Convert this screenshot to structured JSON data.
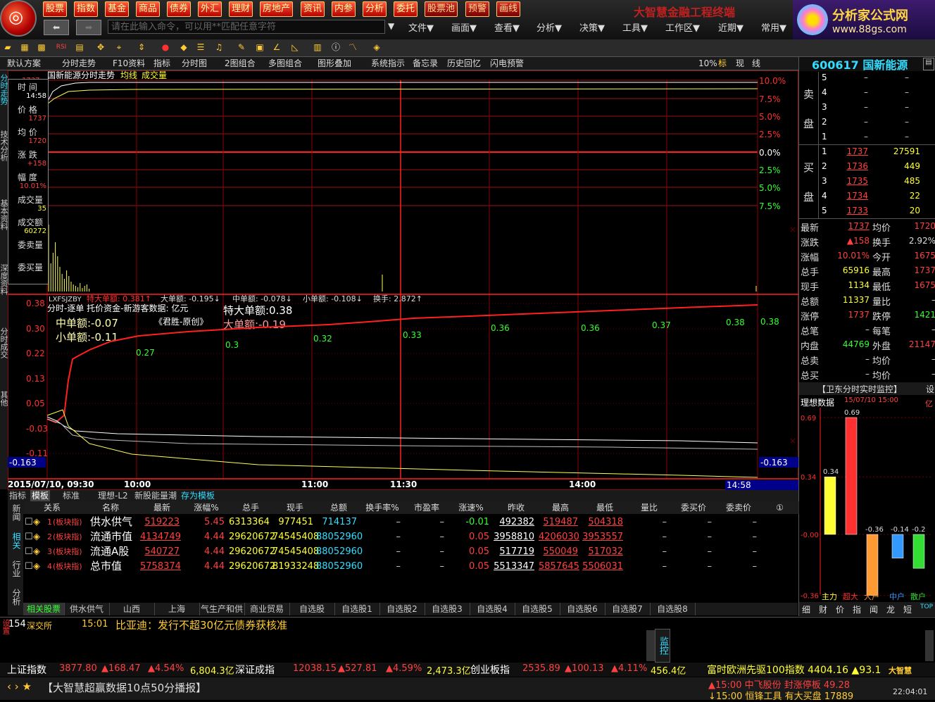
{
  "app": {
    "title": "大智慧金融工程终端",
    "brand_name": "分析家公式网",
    "brand_url": "www.88gs.com",
    "command_placeholder": "请在此输入命令，可以用**匹配任意字符"
  },
  "menu_buttons": [
    "股票",
    "指数",
    "基金",
    "商品",
    "债券",
    "外汇",
    "理财",
    "房地产",
    "资讯",
    "内参",
    "分析",
    "委托",
    "股票池",
    "预警",
    "画线"
  ],
  "menu_right": [
    "文件▼",
    "画面▼",
    "查看▼",
    "分析▼",
    "决策▼",
    "工具▼",
    "工作区▼",
    "近期▼",
    "常用▼"
  ],
  "tabs": [
    "默认方案",
    "分时走势",
    "F10资料",
    "指标",
    "分时图",
    "2图组合",
    "多图组合",
    "图形叠加",
    "系统指示",
    "备忘录",
    "历史回忆",
    "闪电预警"
  ],
  "tab_right": [
    "10%",
    "标",
    "现",
    "线"
  ],
  "left_tabs": [
    "分时走势",
    "技术分析",
    "基本资料",
    "深度资料",
    "分时成交",
    "其他"
  ],
  "chart": {
    "header": "国新能源分时走势",
    "header_avg": "均线",
    "header_vol": "成交量",
    "pct_labels_up": [
      "10.0%",
      "7.5%",
      "5.0%",
      "2.5%",
      "0.0%"
    ],
    "pct_labels_dn": [
      "2.5%",
      "5.0%",
      "7.5%"
    ],
    "price_top": "1737",
    "time_labels": [
      "2015/07/10, 09:30",
      "10:00",
      "11:00",
      "11:30",
      "14:00"
    ],
    "time_current": "14:58",
    "indicator_name": "LXFSJZBY",
    "indicator_items": [
      {
        "label": "特大单额:",
        "value": "0.381↑",
        "color": "red"
      },
      {
        "label": "大单额:",
        "value": "-0.195↓",
        "color": "white"
      },
      {
        "label": "中单额:",
        "value": "-0.078↓",
        "color": "white"
      },
      {
        "label": "小单额:",
        "value": "-0.108↓",
        "color": "white"
      },
      {
        "label": "换手:",
        "value": "2.872↑",
        "color": "white"
      }
    ],
    "sub_title": "分时-逐单 托价资金-新游客数据: 亿元",
    "sub_quote": "《君胜-原创》",
    "sub_mid": "中单额:-0.07",
    "sub_small": "小单额:-0.11",
    "sub_xl": "特大单额:0.38",
    "sub_large": "大单额:-0.19",
    "sub_yaxis": [
      "0.38",
      "0.30",
      "0.22",
      "0.13",
      "0.05",
      "-0.03",
      "-0.11"
    ],
    "sub_current": "-0.163",
    "sub_right_value": "0.38",
    "sub_right_current": "-0.163",
    "sub_points": [
      "0.27",
      "0.3",
      "0.32",
      "0.33",
      "0.36",
      "0.36",
      "0.37",
      "0.38"
    ]
  },
  "infobox": {
    "time_label": "时 间",
    "time": "14:58",
    "price_label": "价 格",
    "price": "1737",
    "avg_label": "均 价",
    "avg": "1720",
    "chg_label": "涨 跌",
    "chg": "+158",
    "amp_label": "幅 度",
    "amp": "10.01%",
    "vol_label": "成交量",
    "vol": "35",
    "amt_label": "成交额",
    "amt": "60272",
    "sell_label": "委卖量",
    "buy_label": "委买量"
  },
  "quote": {
    "code_name": "600617 国新能源",
    "sell_label": "卖",
    "sell_label2": "盘",
    "buy_label": "买",
    "buy_label2": "盘",
    "asks": [
      {
        "lvl": "5",
        "price": "–",
        "vol": "–"
      },
      {
        "lvl": "4",
        "price": "–",
        "vol": "–"
      },
      {
        "lvl": "3",
        "price": "–",
        "vol": "–"
      },
      {
        "lvl": "2",
        "price": "–",
        "vol": "–"
      },
      {
        "lvl": "1",
        "price": "–",
        "vol": "–"
      }
    ],
    "bids": [
      {
        "lvl": "1",
        "price": "1737",
        "vol": "27591"
      },
      {
        "lvl": "2",
        "price": "1736",
        "vol": "449"
      },
      {
        "lvl": "3",
        "price": "1735",
        "vol": "485"
      },
      {
        "lvl": "4",
        "price": "1734",
        "vol": "22"
      },
      {
        "lvl": "5",
        "price": "1733",
        "vol": "20"
      }
    ],
    "stats": [
      {
        "l1": "最新",
        "v1": "1737",
        "c1": "up",
        "l2": "均价",
        "v2": "1720",
        "c2": "up"
      },
      {
        "l1": "涨跌",
        "v1": "▲158",
        "c1": "up",
        "l2": "换手",
        "v2": "2.92%",
        "c2": "wht"
      },
      {
        "l1": "涨幅",
        "v1": "10.01%",
        "c1": "up",
        "l2": "今开",
        "v2": "1675",
        "c2": "up"
      },
      {
        "l1": "总手",
        "v1": "65916",
        "c1": "yel",
        "l2": "最高",
        "v2": "1737",
        "c2": "up"
      },
      {
        "l1": "现手",
        "v1": "1134",
        "c1": "yel",
        "l2": "最低",
        "v2": "1675",
        "c2": "up"
      },
      {
        "l1": "总额",
        "v1": "11337",
        "c1": "yel",
        "l2": "量比",
        "v2": "–",
        "c2": "wht"
      },
      {
        "l1": "涨停",
        "v1": "1737",
        "c1": "up",
        "l2": "跌停",
        "v2": "1421",
        "c2": "dn"
      },
      {
        "l1": "总笔",
        "v1": "–",
        "c1": "wht",
        "l2": "每笔",
        "v2": "–",
        "c2": "wht"
      },
      {
        "l1": "内盘",
        "v1": "44769",
        "c1": "dn",
        "l2": "外盘",
        "v2": "21147",
        "c2": "up"
      },
      {
        "l1": "总卖",
        "v1": "–",
        "c1": "wht",
        "l2": "均价",
        "v2": "–",
        "c2": "wht"
      },
      {
        "l1": "总买",
        "v1": "–",
        "c1": "wht",
        "l2": "均价",
        "v2": "–",
        "c2": "wht"
      }
    ]
  },
  "monitor": {
    "title": "【卫东分时实时监控】",
    "settings": "设",
    "subtitle": "理想数据",
    "date": "15/07/10 15:00",
    "unit": "亿",
    "yaxis": [
      "0.69",
      "0.34",
      "-0.00",
      "-0.36"
    ],
    "bars": [
      {
        "name": "主力",
        "value": 0.34,
        "label": "0.34",
        "color": "#ffff33"
      },
      {
        "name": "超大",
        "value": 0.69,
        "label": "0.69",
        "color": "#ff3030"
      },
      {
        "name": "大户",
        "value": -0.36,
        "label": "-0.36",
        "color": "#ff9933"
      },
      {
        "name": "中户",
        "value": -0.14,
        "label": "-0.14",
        "color": "#3399ff"
      },
      {
        "name": "散户",
        "value": -0.2,
        "label": "-0.2",
        "color": "#33dd33"
      }
    ],
    "bottom_tabs": [
      "细",
      "财",
      "价",
      "指",
      "闻",
      "龙",
      "短",
      "TOP"
    ]
  },
  "table": {
    "top_tabs": [
      "指标",
      "模板",
      "标准",
      "理想-L2",
      "新股能量潮",
      "存为模板"
    ],
    "side_tabs": [
      "新闻",
      "相关",
      "行业",
      "分析"
    ],
    "headers": [
      "关系",
      "名称",
      "最新",
      "涨幅%",
      "总手",
      "现手",
      "总额",
      "换手率%",
      "市盈率",
      "涨速%",
      "昨收",
      "最高",
      "最低",
      "量比",
      "委买价",
      "委卖价"
    ],
    "rows": [
      {
        "idx": "1",
        "rel": "(板块指)",
        "name": "供水供气",
        "last": "519223",
        "pct": "5.45",
        "vol": "6313364",
        "cur": "977451",
        "amt": "714137",
        "turn": "–",
        "pe": "–",
        "speed": "-0.01",
        "prev": "492382",
        "high": "519487",
        "low": "504318",
        "ratio": "–",
        "bid": "–",
        "ask": "–"
      },
      {
        "idx": "2",
        "rel": "(板块指)",
        "name": "流通市值",
        "last": "4134749",
        "pct": "4.44",
        "vol": "29620672",
        "cur": "74545408",
        "amt": "88052960",
        "turn": "–",
        "pe": "–",
        "speed": "0.05",
        "prev": "3958810",
        "high": "4206030",
        "low": "3953557",
        "ratio": "–",
        "bid": "–",
        "ask": "–"
      },
      {
        "idx": "3",
        "rel": "(板块指)",
        "name": "流通A股",
        "last": "540727",
        "pct": "4.44",
        "vol": "29620672",
        "cur": "74545408",
        "amt": "88052960",
        "turn": "–",
        "pe": "–",
        "speed": "0.05",
        "prev": "517719",
        "high": "550049",
        "low": "517032",
        "ratio": "–",
        "bid": "–",
        "ask": "–"
      },
      {
        "idx": "4",
        "rel": "(板块指)",
        "name": "总市值",
        "last": "5758374",
        "pct": "4.44",
        "vol": "29620672",
        "cur": "81933248",
        "amt": "88052960",
        "turn": "–",
        "pe": "–",
        "speed": "0.05",
        "prev": "5513347",
        "high": "5857645",
        "low": "5506031",
        "ratio": "–",
        "bid": "–",
        "ask": "–"
      }
    ],
    "bottom_tabs": [
      "相关股票",
      "供水供气",
      "山西",
      "上海",
      "气生产和供应",
      "商业贸易",
      "自选股",
      "自选股1",
      "自选股2",
      "自选股3",
      "自选股4",
      "自选股5",
      "自选股6",
      "自选股7",
      "自选股8"
    ]
  },
  "news": {
    "code": "154",
    "exchange": "深交所",
    "time": "15:01",
    "text": "比亚迪：发行不超30亿元债券获核准",
    "monitor_label": "监控",
    "side_label": "设置"
  },
  "indices": [
    {
      "name": "上证指数",
      "val": "3877.80",
      "chg": "▲168.47",
      "pct": "▲4.54%",
      "amt": "6,804.3亿"
    },
    {
      "name": "深证成指",
      "val": "12038.15",
      "chg": "▲527.81",
      "pct": "▲4.59%",
      "amt": "2,473.3亿"
    },
    {
      "name": "创业板指",
      "val": "2535.89",
      "chg": "▲100.13",
      "pct": "▲4.11%",
      "amt": "456.4亿"
    }
  ],
  "ticker_right": "富时欧洲先驱100指数 4404.16 ▲93.1",
  "status": {
    "broadcast": "【大智慧超赢数据10点50分播报】",
    "alert1": "▲15:00 中飞股份 封涨停板 49.28",
    "alert2": "↓15:00 恒锋工具 有大买盘 17889",
    "clock": "22:04:01",
    "brand_small": "大智慧"
  }
}
